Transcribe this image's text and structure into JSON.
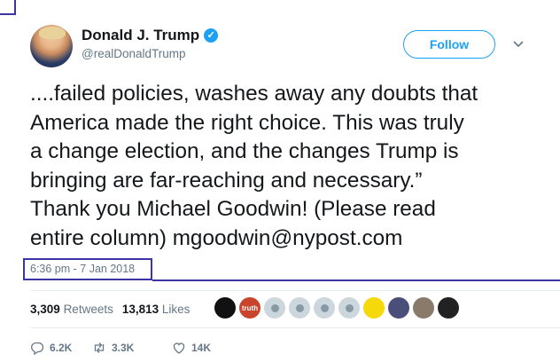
{
  "author": {
    "name": "Donald J. Trump",
    "handle": "@realDonaldTrump"
  },
  "follow_label": "Follow",
  "tweet": {
    "text": "....failed policies, washes away any doubts that\nAmerica made the right choice. This was truly\na change election, and the changes Trump is\nbringing are far-reaching and necessary.”\nThank you Michael Goodwin! (Please read\nentire column) mgoodwin@nypost.com",
    "timestamp": "6:36 pm - 7 Jan 2018"
  },
  "stats": {
    "retweets_count": "3,309",
    "retweets_label": "Retweets",
    "likes_count": "13,813",
    "likes_label": "Likes"
  },
  "liker_badge_text": "truth",
  "actions": {
    "replies": "6.2K",
    "retweets": "3.3K",
    "likes": "14K"
  },
  "colors": {
    "accent": "#1da1f2",
    "frame": "#3b35a3",
    "muted": "#657786"
  }
}
